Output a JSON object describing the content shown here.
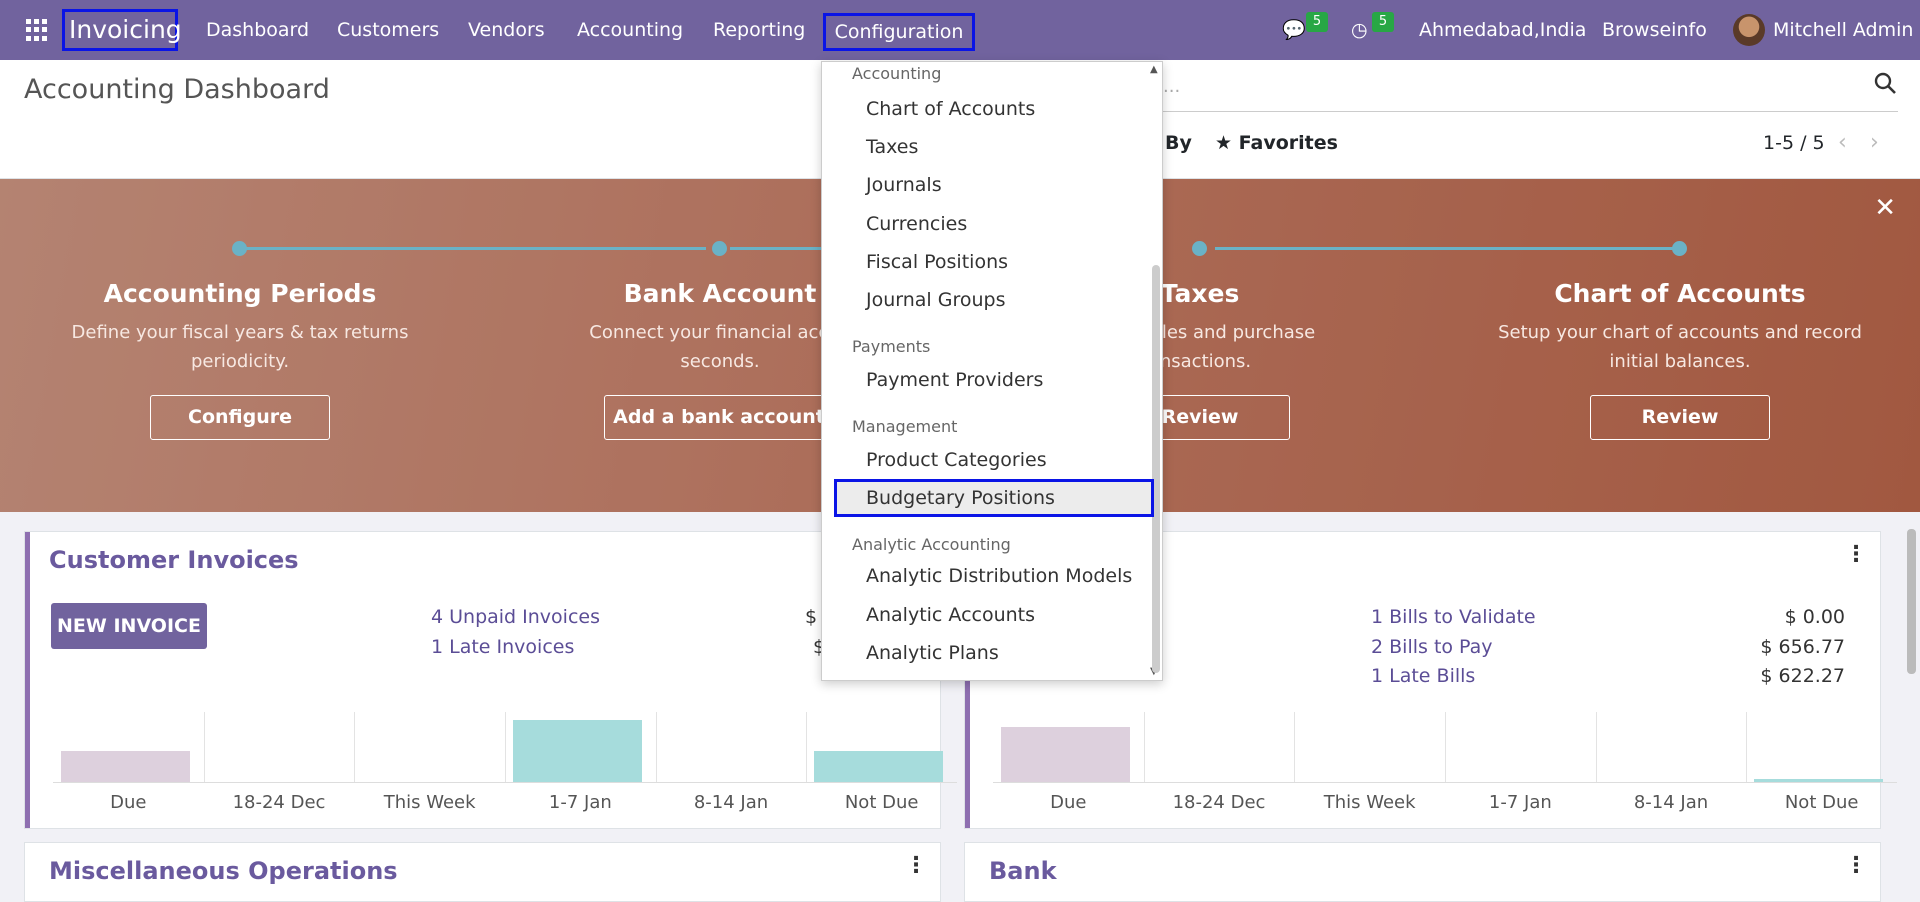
{
  "nav": {
    "brand": "Invoicing",
    "items": [
      "Dashboard",
      "Customers",
      "Vendors",
      "Accounting",
      "Reporting",
      "Configuration"
    ],
    "chat_count": "5",
    "activity_count": "5",
    "company_location": "Ahmedabad,India",
    "company": "Browseinfo",
    "user": "Mitchell Admin"
  },
  "page": {
    "title": "Accounting Dashboard",
    "search_placeholder": "...",
    "group_by": "By",
    "favorites": "Favorites",
    "pager": "1-5 / 5"
  },
  "onboarding": {
    "steps": [
      {
        "title": "Accounting Periods",
        "desc1": "Define your fiscal years & tax returns",
        "desc2": "periodicity.",
        "button": "Configure"
      },
      {
        "title": "Bank Account",
        "desc1": "Connect your financial accou",
        "desc2": "seconds.",
        "button": "Add a bank account"
      },
      {
        "title": "Taxes",
        "desc1": "es for sales and purchase",
        "desc2": "ansactions.",
        "button": "Review"
      },
      {
        "title": "Chart of Accounts",
        "desc1": "Setup your chart of accounts and record",
        "desc2": "initial balances.",
        "button": "Review"
      }
    ]
  },
  "customer_invoices": {
    "title": "Customer Invoices",
    "new_button": "NEW INVOICE",
    "links": [
      "4 Unpaid Invoices",
      "1 Late Invoices"
    ],
    "amounts": [
      "$",
      "$"
    ],
    "chart_data": {
      "type": "bar",
      "categories": [
        "Due",
        "18-24 Dec",
        "This Week",
        "1-7 Jan",
        "8-14 Jan",
        "Not Due"
      ],
      "values": [
        0.45,
        0,
        0,
        0.88,
        0,
        0.45
      ],
      "colors": [
        "#ddd0dd",
        "",
        "",
        "#a6dcdc",
        "",
        "#a6dcdc"
      ]
    }
  },
  "vendor_bills": {
    "links": [
      "1 Bills to Validate",
      "2 Bills to Pay",
      "1 Late Bills"
    ],
    "amounts": [
      "$ 0.00",
      "$ 656.77",
      "$ 622.27"
    ],
    "chart_data": {
      "type": "bar",
      "categories": [
        "Due",
        "18-24 Dec",
        "This Week",
        "1-7 Jan",
        "8-14 Jan",
        "Not Due"
      ],
      "values": [
        0.78,
        0,
        0,
        0,
        0,
        0.05
      ],
      "colors": [
        "#ddd0dd",
        "",
        "",
        "",
        "",
        "#a6dcdc"
      ]
    }
  },
  "misc": {
    "title": "Miscellaneous Operations"
  },
  "bank": {
    "title": "Bank"
  },
  "dropdown": {
    "sections": [
      {
        "label": "Accounting",
        "items": [
          "Chart of Accounts",
          "Taxes",
          "Journals",
          "Currencies",
          "Fiscal Positions",
          "Journal Groups"
        ]
      },
      {
        "label": "Payments",
        "items": [
          "Payment Providers"
        ]
      },
      {
        "label": "Management",
        "items": [
          "Product Categories",
          "Budgetary Positions"
        ]
      },
      {
        "label": "Analytic Accounting",
        "items": [
          "Analytic Distribution Models",
          "Analytic Accounts",
          "Analytic Plans"
        ]
      }
    ],
    "selected": "Budgetary Positions"
  }
}
